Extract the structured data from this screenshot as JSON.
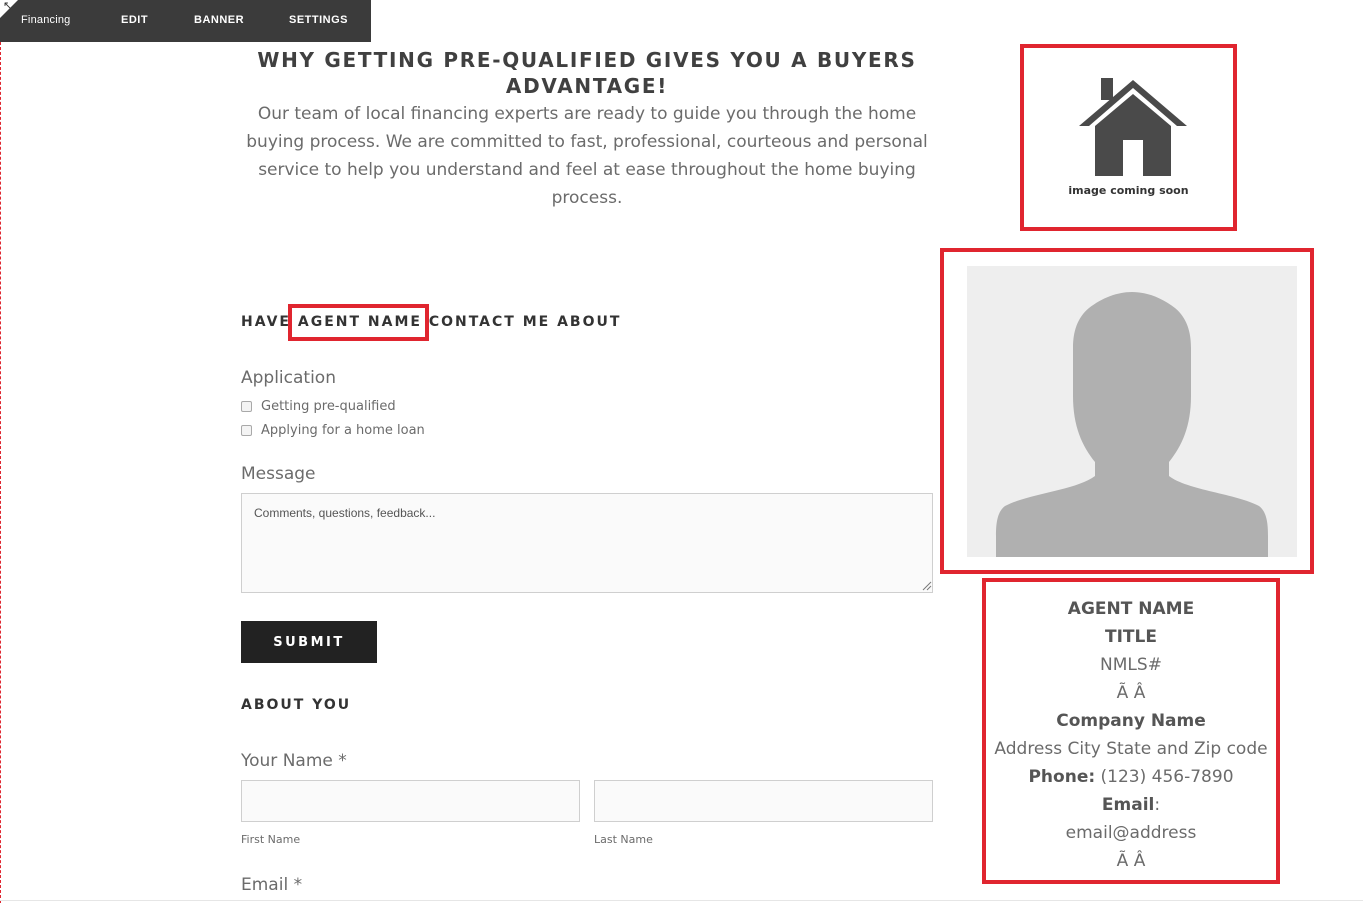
{
  "toolbar": {
    "page_name": "Financing",
    "edit": "EDIT",
    "banner": "BANNER",
    "settings": "SETTINGS"
  },
  "heading": "WHY GETTING PRE-QUALIFIED GIVES YOU A BUYERS ADVANTAGE!",
  "intro": "Our team of local financing experts are ready to guide you through the home buying process. We are committed to fast, professional, courteous and personal service to help you understand and feel at ease throughout the home buying process.",
  "contact_heading": {
    "prefix": "HAVE ",
    "agent": "AGENT NAME",
    "suffix": " CONTACT ME ABOUT"
  },
  "application": {
    "label": "Application",
    "options": [
      "Getting pre-qualified",
      "Applying for a home loan"
    ]
  },
  "message": {
    "label": "Message",
    "placeholder": "Comments, questions, feedback..."
  },
  "submit_label": "SUBMIT",
  "about_you": {
    "heading": "ABOUT YOU",
    "name_label": "Your Name *",
    "first_name": "First Name",
    "last_name": "Last Name",
    "email_label": "Email *"
  },
  "image_placeholder": {
    "icon": "house-icon",
    "text": "image coming soon"
  },
  "agent_card": {
    "name": "AGENT NAME",
    "title": "TITLE",
    "nmls": "NMLS#",
    "garble1": "Ã Â",
    "company": "Company Name",
    "address": "Address City State and Zip code",
    "phone_label": "Phone:",
    "phone": " (123) 456-7890",
    "email_label": "Email",
    "email_colon": ":",
    "email": "email@address",
    "garble2": "Ã Â"
  },
  "colors": {
    "highlight_border": "#e0252f",
    "toolbar_bg": "#3b3b3b",
    "button_bg": "#222222"
  }
}
